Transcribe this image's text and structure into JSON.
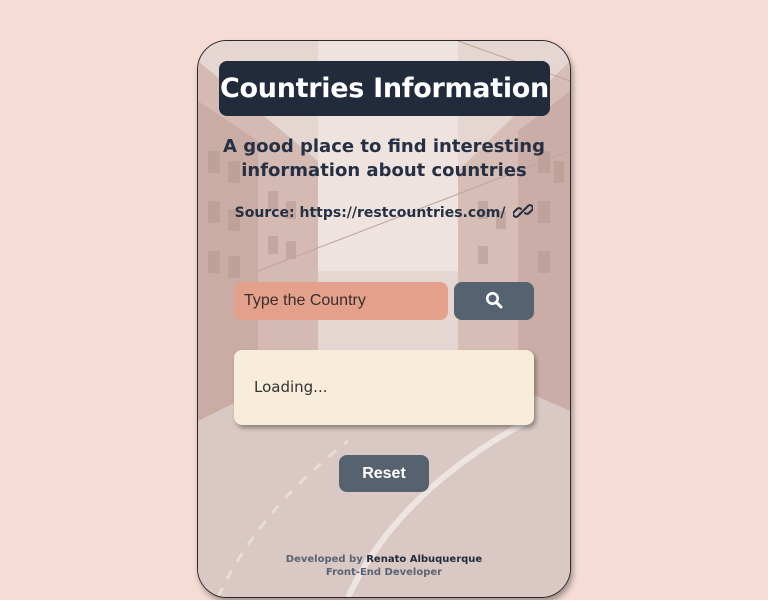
{
  "header": {
    "title": "Countries Information",
    "subtitle": "A good place to find interesting information about countries",
    "source_text": "Source: https://restcountries.com/"
  },
  "search": {
    "placeholder": "Type the Country",
    "button_icon": "search-icon"
  },
  "result": {
    "status_text": "Loading..."
  },
  "actions": {
    "reset_label": "Reset"
  },
  "footer": {
    "developed_by_label": "Developed by",
    "author_name": "Renato Albuquerque",
    "role": "Front-End Developer"
  },
  "colors": {
    "page_bg": "#f6dcd5",
    "title_bg": "#222b3b",
    "input_bg": "#e3a08a",
    "button_bg": "#556270",
    "result_bg": "#f8eddb"
  }
}
